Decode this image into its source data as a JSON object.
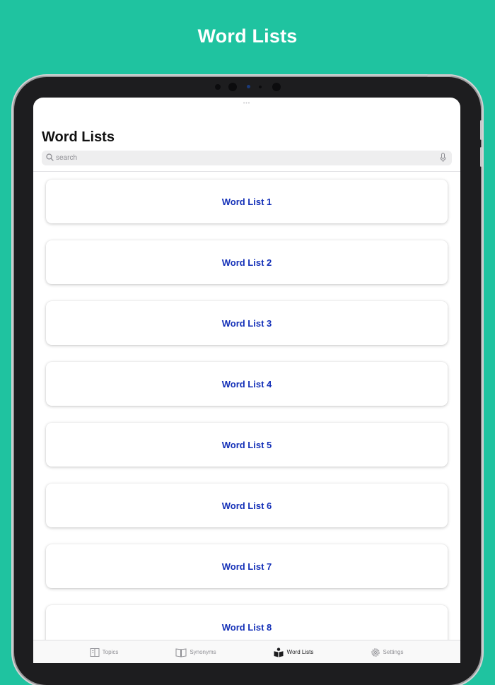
{
  "promo": {
    "title": "Word Lists"
  },
  "nav": {
    "title": "Word Lists"
  },
  "search": {
    "placeholder": "search",
    "value": ""
  },
  "list": {
    "items": [
      {
        "label": "Word List 1"
      },
      {
        "label": "Word List 2"
      },
      {
        "label": "Word List 3"
      },
      {
        "label": "Word List 4"
      },
      {
        "label": "Word List 5"
      },
      {
        "label": "Word List 6"
      },
      {
        "label": "Word List 7"
      },
      {
        "label": "Word List 8"
      }
    ]
  },
  "tabbar": {
    "tabs": [
      {
        "label": "Topics",
        "icon": "topics-icon",
        "active": false
      },
      {
        "label": "Synonyms",
        "icon": "book-icon",
        "active": false
      },
      {
        "label": "Word Lists",
        "icon": "reader-icon",
        "active": true
      },
      {
        "label": "Settings",
        "icon": "gear-icon",
        "active": false
      }
    ]
  },
  "colors": {
    "background": "#1fc3a0",
    "accent_text": "#1531b8",
    "device_bezel": "#1d1d1f"
  }
}
